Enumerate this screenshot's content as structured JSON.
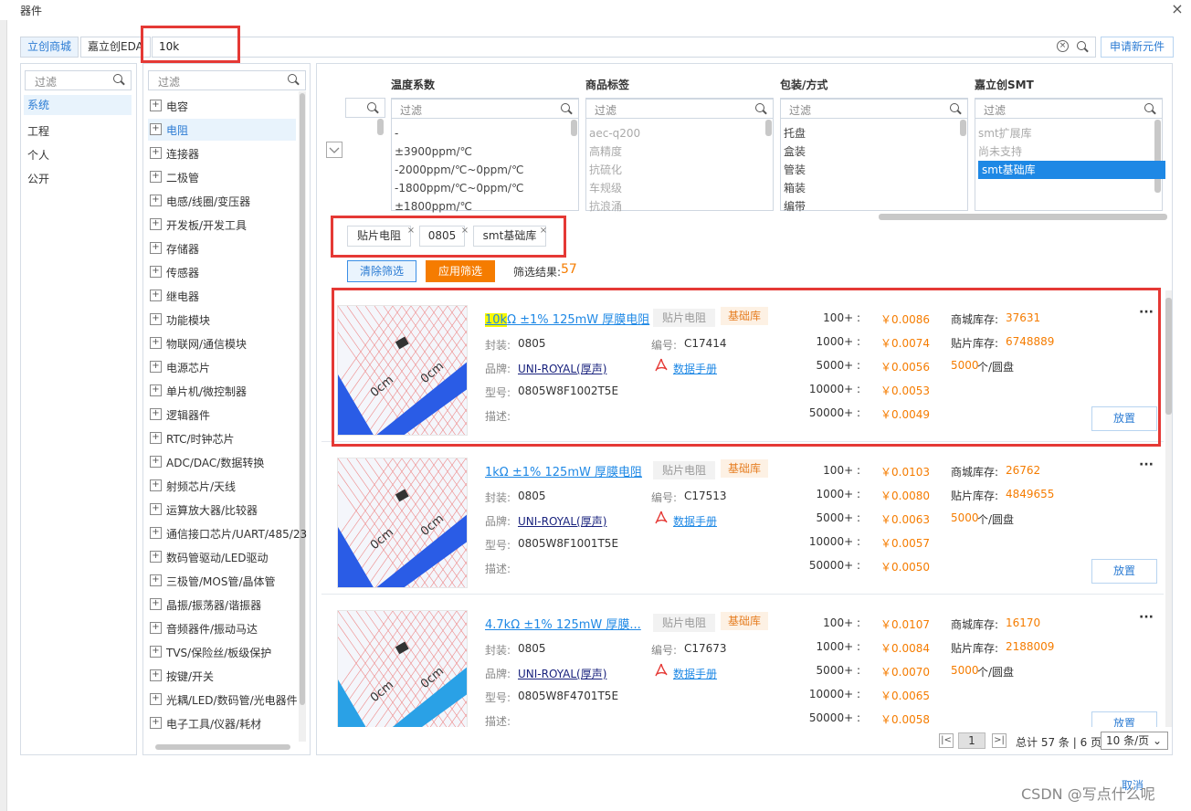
{
  "window": {
    "title": "器件",
    "close": "×"
  },
  "search": {
    "tabs": [
      "立创商城",
      "嘉立创EDA"
    ],
    "value": "10k",
    "apply_new": "申请新元件"
  },
  "library": {
    "filter_placeholder": "过滤",
    "items": [
      "系统",
      "工程",
      "个人",
      "公开"
    ]
  },
  "categories": {
    "filter_placeholder": "过滤",
    "items": [
      "电容",
      "电阻",
      "连接器",
      "二极管",
      "电感/线圈/变压器",
      "开发板/开发工具",
      "存储器",
      "传感器",
      "继电器",
      "功能模块",
      "物联网/通信模块",
      "电源芯片",
      "单片机/微控制器",
      "逻辑器件",
      "RTC/时钟芯片",
      "ADC/DAC/数据转换",
      "射频芯片/天线",
      "运算放大器/比较器",
      "通信接口芯片/UART/485/23",
      "数码管驱动/LED驱动",
      "三极管/MOS管/晶体管",
      "晶振/振荡器/谐振器",
      "音频器件/振动马达",
      "TVS/保险丝/板级保护",
      "按键/开关",
      "光耦/LED/数码管/光电器件",
      "电子工具/仪器/耗材"
    ]
  },
  "filters": {
    "filter_placeholder": "过滤",
    "columns": [
      {
        "title": "温度系数",
        "options": [
          "-",
          "±3900ppm/℃",
          "-2000ppm/℃~0ppm/℃",
          "-1800ppm/℃~0ppm/℃",
          "±1800ppm/℃"
        ]
      },
      {
        "title": "商品标签",
        "options": [
          "aec-q200",
          "高精度",
          "抗硫化",
          "车规级",
          "抗浪涌"
        ]
      },
      {
        "title": "包装/方式",
        "options": [
          "托盘",
          "盒装",
          "管装",
          "箱装",
          "编带"
        ]
      },
      {
        "title": "嘉立创SMT",
        "options": [
          "smt扩展库",
          "尚未支持",
          "smt基础库"
        ]
      }
    ],
    "chips": [
      "贴片电阻",
      "0805",
      "smt基础库"
    ],
    "chip_remove": "×",
    "clear_label": "清除筛选",
    "apply_label": "应用筛选",
    "result_label": "筛选结果:",
    "result_count": "57"
  },
  "products": [
    {
      "name_hl": "10k",
      "name_rest": "Ω ±1% 125mW 厚膜电阻",
      "tag_type": "贴片电阻",
      "tag_lib": "基础库",
      "package_label": "封装:",
      "package": "0805",
      "code_label": "编号:",
      "code": "C17414",
      "brand_label": "品牌:",
      "brand": "UNI-ROYAL(厚声)",
      "datasheet": "数据手册",
      "model_label": "型号:",
      "model": "0805W8F1002T5E",
      "desc_label": "描述:",
      "prices": [
        {
          "qty": "100+ :",
          "price": "￥0.0086"
        },
        {
          "qty": "1000+ :",
          "price": "￥0.0074"
        },
        {
          "qty": "5000+ :",
          "price": "￥0.0056"
        },
        {
          "qty": "10000+ :",
          "price": "￥0.0053"
        },
        {
          "qty": "50000+ :",
          "price": "￥0.0049"
        }
      ],
      "mall_stock_label": "商城库存:",
      "mall_stock": "37631",
      "smt_stock_label": "贴片库存:",
      "smt_stock": "6748889",
      "reel_qty": "5000",
      "reel_label": "个/圆盘",
      "more": "···",
      "place": "放置"
    },
    {
      "name_hl": "",
      "name_rest": "1kΩ ±1% 125mW 厚膜电阻",
      "tag_type": "贴片电阻",
      "tag_lib": "基础库",
      "package_label": "封装:",
      "package": "0805",
      "code_label": "编号:",
      "code": "C17513",
      "brand_label": "品牌:",
      "brand": "UNI-ROYAL(厚声)",
      "datasheet": "数据手册",
      "model_label": "型号:",
      "model": "0805W8F1001T5E",
      "desc_label": "描述:",
      "prices": [
        {
          "qty": "100+ :",
          "price": "￥0.0103"
        },
        {
          "qty": "1000+ :",
          "price": "￥0.0080"
        },
        {
          "qty": "5000+ :",
          "price": "￥0.0063"
        },
        {
          "qty": "10000+ :",
          "price": "￥0.0057"
        },
        {
          "qty": "50000+ :",
          "price": "￥0.0050"
        }
      ],
      "mall_stock_label": "商城库存:",
      "mall_stock": "26762",
      "smt_stock_label": "贴片库存:",
      "smt_stock": "4849655",
      "reel_qty": "5000",
      "reel_label": "个/圆盘",
      "more": "···",
      "place": "放置"
    },
    {
      "name_hl": "",
      "name_rest": "4.7kΩ ±1% 125mW 厚膜...",
      "tag_type": "贴片电阻",
      "tag_lib": "基础库",
      "package_label": "封装:",
      "package": "0805",
      "code_label": "编号:",
      "code": "C17673",
      "brand_label": "品牌:",
      "brand": "UNI-ROYAL(厚声)",
      "datasheet": "数据手册",
      "model_label": "型号:",
      "model": "0805W8F4701T5E",
      "desc_label": "描述:",
      "prices": [
        {
          "qty": "100+ :",
          "price": "￥0.0107"
        },
        {
          "qty": "1000+ :",
          "price": "￥0.0084"
        },
        {
          "qty": "5000+ :",
          "price": "￥0.0070"
        },
        {
          "qty": "10000+ :",
          "price": "￥0.0065"
        },
        {
          "qty": "50000+ :",
          "price": "￥0.0058"
        }
      ],
      "mall_stock_label": "商城库存:",
      "mall_stock": "16170",
      "smt_stock_label": "贴片库存:",
      "smt_stock": "2188009",
      "reel_qty": "5000",
      "reel_label": "个/圆盘",
      "more": "···",
      "place": "放置"
    }
  ],
  "pagination": {
    "first": "|<",
    "last": ">|",
    "page": "1",
    "total": "总计 57 条 | 6 页",
    "page_size": "10 条/页 ⌄"
  },
  "footer": {
    "cancel": "取消",
    "watermark": "CSDN @写点什么呢"
  },
  "colors": {
    "accent": "#1e88e5",
    "price": "#f57c00",
    "highlight_box": "#e53935"
  }
}
